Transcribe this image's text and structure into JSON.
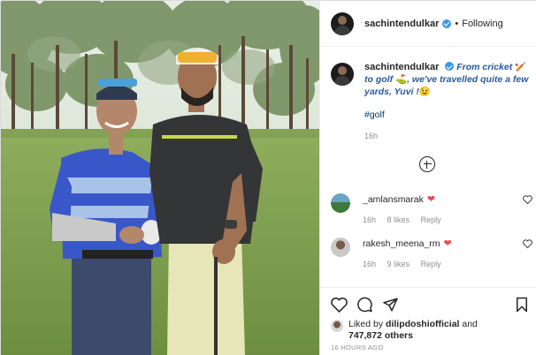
{
  "post": {
    "author": "sachintendulkar",
    "separator": "•",
    "follow_status": "Following",
    "caption_text": "From cricket",
    "caption_emoji_1": "🏏",
    "caption_text_2": "to golf",
    "caption_emoji_2": "⛳",
    "caption_text_3": ", we've travelled quite a few yards, Yuvi !",
    "caption_emoji_3": "😉",
    "hashtag": "#golf",
    "caption_time": "16h"
  },
  "comments": [
    {
      "user": "_amlansmarak",
      "reaction": "❤",
      "time": "16h",
      "likes": "8 likes",
      "reply": "Reply"
    },
    {
      "user": "rakesh_meena_rm",
      "reaction": "❤",
      "time": "16h",
      "likes": "9 likes",
      "reply": "Reply"
    }
  ],
  "engagement": {
    "liked_by_prefix": "Liked by",
    "liked_by_user": "dilipdoshiofficial",
    "liked_by_and": "and",
    "liked_by_count": "747,872 others",
    "post_time": "16 HOURS AGO"
  },
  "icons": {
    "verified": "verified-badge-icon",
    "add_comments": "plus-circle-icon",
    "comment_like": "heart-outline-icon",
    "like": "heart-outline-icon",
    "comment": "comment-bubble-icon",
    "share": "paper-plane-icon",
    "save": "bookmark-icon"
  },
  "colors": {
    "verified": "#3897f0",
    "heart": "#ed4956",
    "caption_italic": "#2a5a9a",
    "hashtag": "#00376b",
    "muted": "#8e8e8e"
  }
}
